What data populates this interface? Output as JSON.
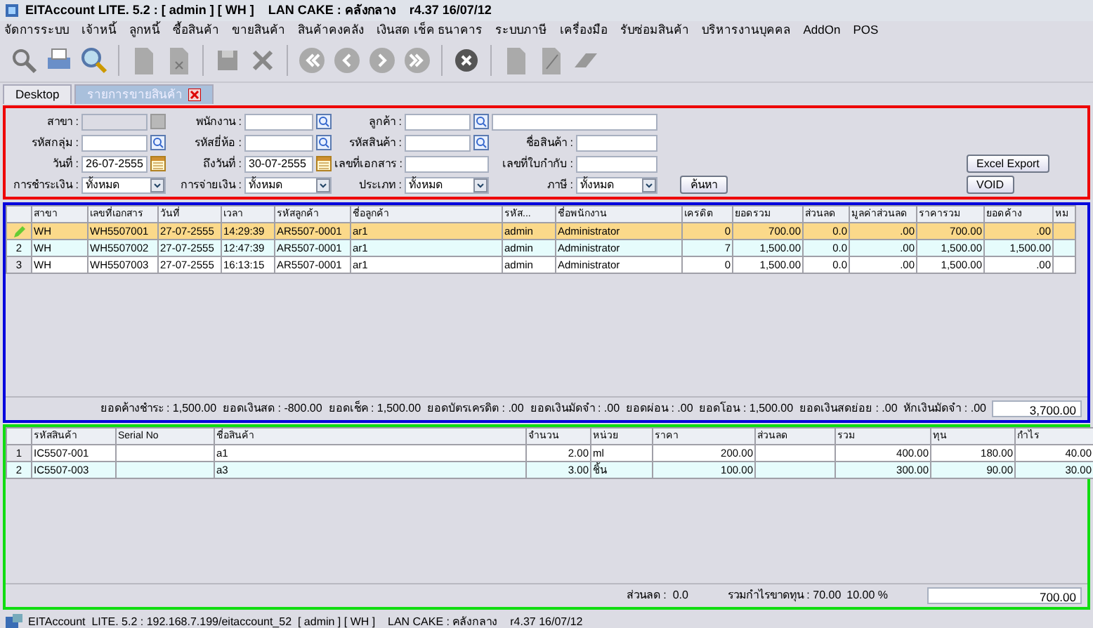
{
  "window": {
    "title": "EITAccount LITE. 5.2 : [ admin ] [ WH ]    LAN CAKE : คลังกลาง    r4.37 16/07/12"
  },
  "menu": [
    "จัดการระบบ",
    "เจ้าหนี้",
    "ลูกหนี้",
    "ซื้อสินค้า",
    "ขายสินค้า",
    "สินค้าคงคลัง",
    "เงินสด เช็ค ธนาคาร",
    "ระบบภาษี",
    "เครื่องมือ",
    "รับซ่อมสินค้า",
    "บริหารงานบุคคล",
    "AddOn",
    "POS"
  ],
  "tabs": [
    {
      "label": "Desktop",
      "selected": false,
      "closable": false
    },
    {
      "label": "รายการขายสินค้า",
      "selected": true,
      "closable": true
    }
  ],
  "filters": [
    [
      {
        "label": "สาขา :",
        "kind": "lookup",
        "disabled": true
      },
      {
        "label": "พนักงาน :",
        "kind": "lookup",
        "disabled": false
      },
      {
        "label": "ลูกค้า :",
        "kind": "lookup",
        "disabled": false
      },
      {
        "kind": "wide"
      }
    ],
    [
      {
        "label": "รหัสกลุ่ม :",
        "kind": "lookup",
        "disabled": false
      },
      {
        "label": "รหัสยี่ห้อ :",
        "kind": "lookup",
        "disabled": false
      },
      {
        "label": "รหัสสินค้า :",
        "kind": "lookup",
        "disabled": false
      },
      {
        "label": "ชื่อสินค้า :",
        "kind": "text"
      }
    ],
    [
      {
        "label": "วันที่ :",
        "kind": "date",
        "value": "26-07-2555"
      },
      {
        "label": "ถึงวันที่ :",
        "kind": "date",
        "value": "30-07-2555"
      },
      {
        "label": "เลขที่เอกสาร :",
        "kind": "text"
      },
      {
        "label": "เลขที่ใบกำกับ :",
        "kind": "text"
      }
    ],
    [
      {
        "label": "การชำระเงิน :",
        "kind": "select",
        "value": "ทั้งหมด"
      },
      {
        "label": "การจ่ายเงิน :",
        "kind": "select",
        "value": "ทั้งหมด"
      },
      {
        "label": "ประเภท :",
        "kind": "select",
        "value": "ทั้งหมด"
      },
      {
        "label": "ภาษี :",
        "kind": "select",
        "value": "ทั้งหมด"
      }
    ]
  ],
  "search_button": "ค้นหา",
  "side_buttons": [
    "Excel Export",
    "VOID"
  ],
  "sales_table": {
    "columns": [
      "สาขา",
      "เลขที่เอกสาร",
      "วันที่",
      "เวลา",
      "รหัสลูกค้า",
      "ชื่อลูกค้า",
      "รหัส...",
      "ชื่อพนักงาน",
      "เครดิต",
      "ยอดรวม",
      "ส่วนลด",
      "มูลค่าส่วนลด",
      "ราคารวม",
      "ยอดค้าง",
      "หม"
    ],
    "rows": [
      {
        "selected": true,
        "editing": true,
        "cells": [
          "WH",
          "WH5507001",
          "27-07-2555",
          "14:29:39",
          "AR5507-0001",
          "ar1",
          "admin",
          "Administrator",
          "0",
          "700.00",
          "0.0",
          ".00",
          "700.00",
          ".00",
          ""
        ]
      },
      {
        "selected": false,
        "editing": false,
        "number": "2",
        "cells": [
          "WH",
          "WH5507002",
          "27-07-2555",
          "12:47:39",
          "AR5507-0001",
          "ar1",
          "admin",
          "Administrator",
          "7",
          "1,500.00",
          "0.0",
          ".00",
          "1,500.00",
          "1,500.00",
          ""
        ]
      },
      {
        "selected": false,
        "editing": false,
        "number": "3",
        "cells": [
          "WH",
          "WH5507003",
          "27-07-2555",
          "16:13:15",
          "AR5507-0001",
          "ar1",
          "admin",
          "Administrator",
          "0",
          "1,500.00",
          "0.0",
          ".00",
          "1,500.00",
          ".00",
          ""
        ]
      }
    ]
  },
  "summary": {
    "text": "ยอดค้างชำระ : 1,500.00  ยอดเงินสด : -800.00  ยอดเช็ค : 1,500.00  ยอดบัตรเครดิต : .00  ยอดเงินมัดจำ : .00  ยอดผ่อน : .00  ยอดโอน : 1,500.00  ยอดเงินสดย่อย : .00  หักเงินมัดจำ : .00",
    "total": "3,700.00"
  },
  "items_table": {
    "columns": [
      "รหัสสินค้า",
      "Serial No",
      "ชื่อสินค้า",
      "จำนวน",
      "หน่วย",
      "ราคา",
      "ส่วนลด",
      "รวม",
      "ทุน",
      "กำไร"
    ],
    "rows": [
      {
        "number": "1",
        "cells": [
          "IC5507-001",
          "",
          "a1",
          "2.00",
          "ml",
          "200.00",
          "",
          "400.00",
          "180.00",
          "40.00"
        ]
      },
      {
        "number": "2",
        "cells": [
          "IC5507-003",
          "",
          "a3",
          "3.00",
          "ชิ้น",
          "100.00",
          "",
          "300.00",
          "90.00",
          "30.00"
        ]
      }
    ]
  },
  "items_footer": {
    "discount": "ส่วนลด :  0.0",
    "profit": "รวมกำไรขาดทุน : 70.00",
    "percent": "10.00 %",
    "total": "700.00"
  },
  "status_bar": "EITAccount  LITE. 5.2 : 192.168.7.199/eitaccount_52  [ admin ] [ WH ]    LAN CAKE : คลังกลาง    r4.37 16/07/12"
}
